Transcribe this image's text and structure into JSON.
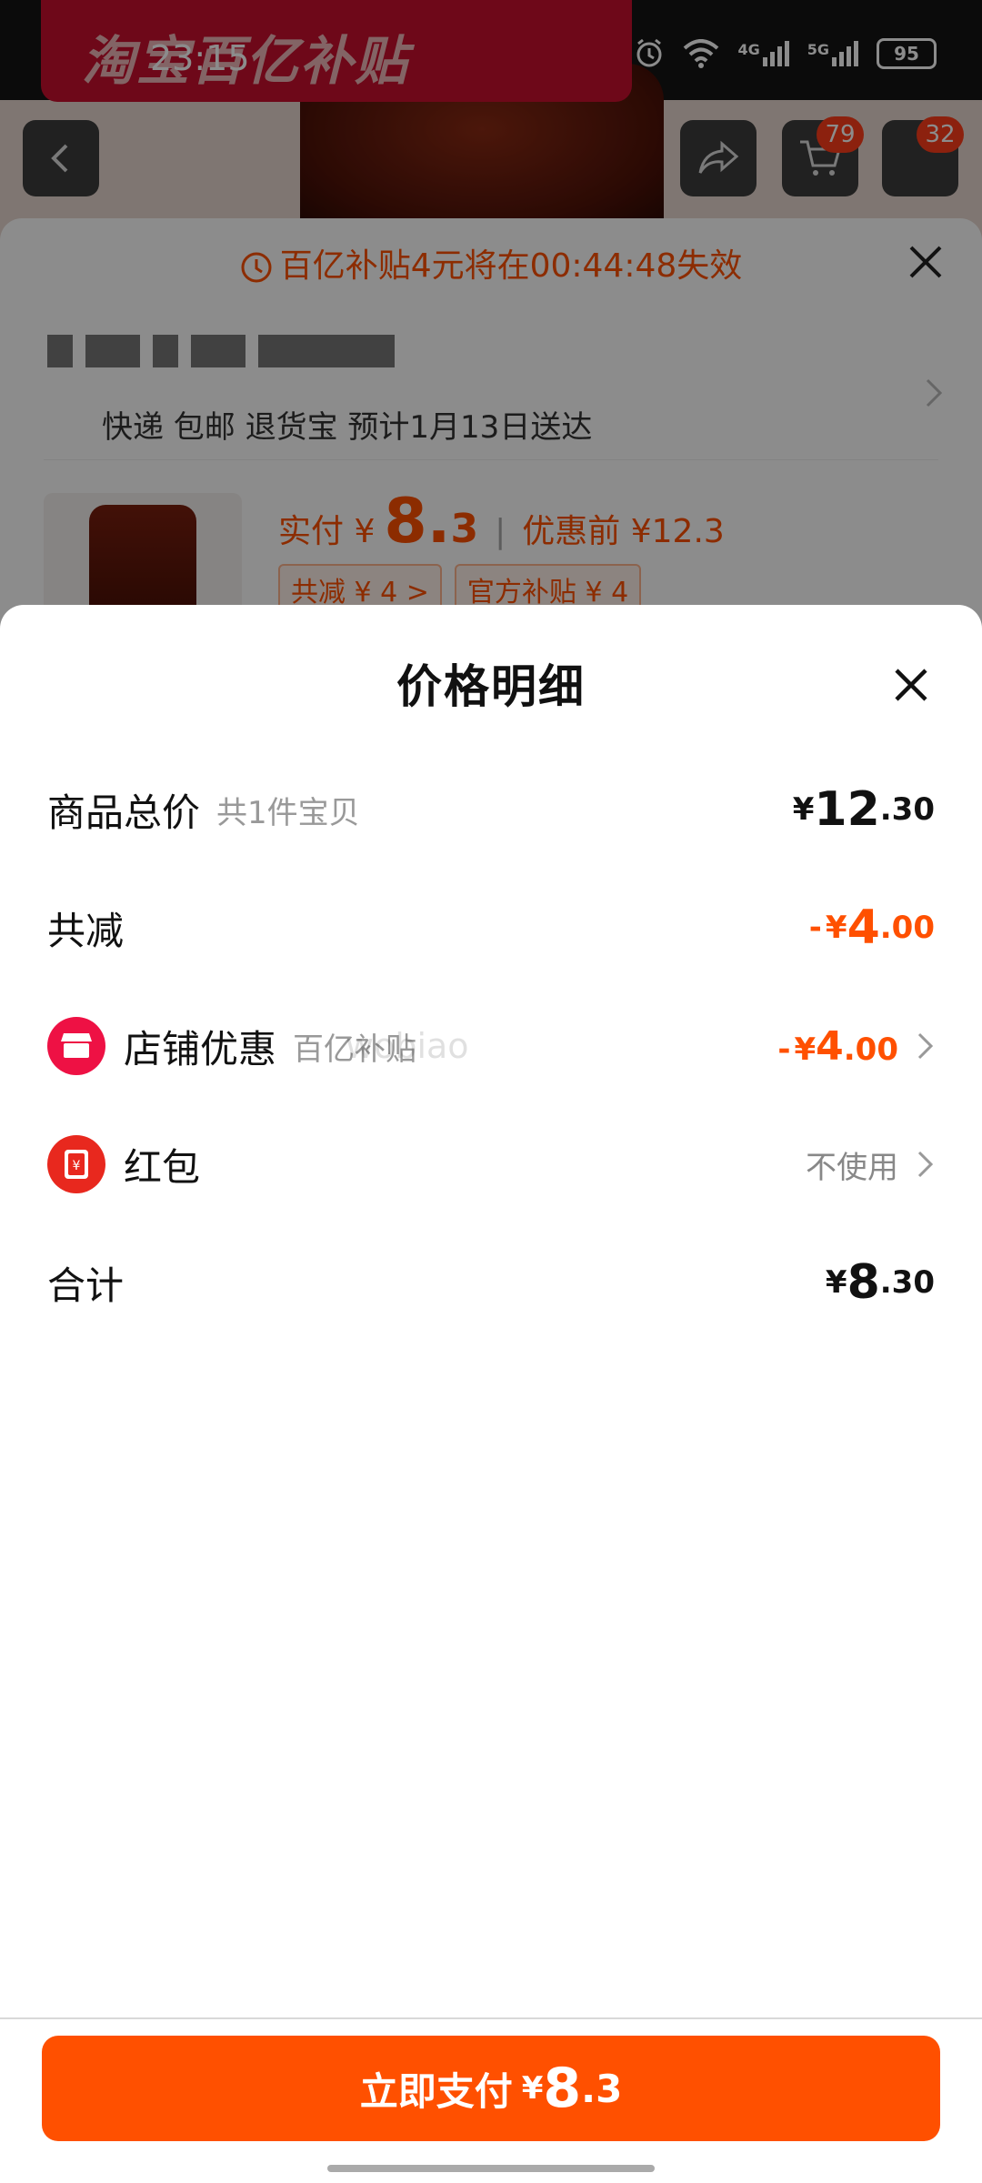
{
  "status_bar": {
    "time": "23:15",
    "battery": "95",
    "signal_labels": [
      "4G",
      "5G"
    ]
  },
  "background": {
    "banner_text": "淘宝百亿补贴",
    "cart_badge": "79",
    "more_badge": "32",
    "countdown": "百亿补贴4元将在00:44:48失效",
    "delivery": "快递 包邮 退货宝 预计1月13日送达",
    "paid_prefix": "实付 ¥",
    "paid_int": "8.",
    "paid_dec": "3",
    "before_label": "优惠前 ¥12.3",
    "tag_reduce": "共减 ¥ 4 >",
    "tag_subsidy": "官方补贴 ¥ 4"
  },
  "sheet": {
    "title": "价格明细",
    "rows": {
      "total": {
        "label": "商品总价",
        "sub": "共1件宝贝",
        "currency": "¥",
        "int": "12",
        "dec": ".30"
      },
      "reduce": {
        "label": "共减",
        "minus": "-",
        "currency": "¥",
        "int": "4",
        "dec": ".00"
      },
      "shop": {
        "label": "店铺优惠",
        "sub": "百亿补贴",
        "minus": "-",
        "currency": "¥",
        "int": "4",
        "dec": ".00"
      },
      "redpacket": {
        "label": "红包",
        "value": "不使用"
      },
      "sum": {
        "label": "合计",
        "currency": "¥",
        "int": "8",
        "dec": ".30"
      }
    },
    "watermark": "wobiao"
  },
  "pay_button": {
    "label": "立即支付",
    "currency": "¥",
    "int": "8",
    "dec": ".3"
  },
  "colors": {
    "accent": "#ff5000",
    "shop_icon": "#ee1144",
    "redpacket_icon": "#e8281e"
  }
}
